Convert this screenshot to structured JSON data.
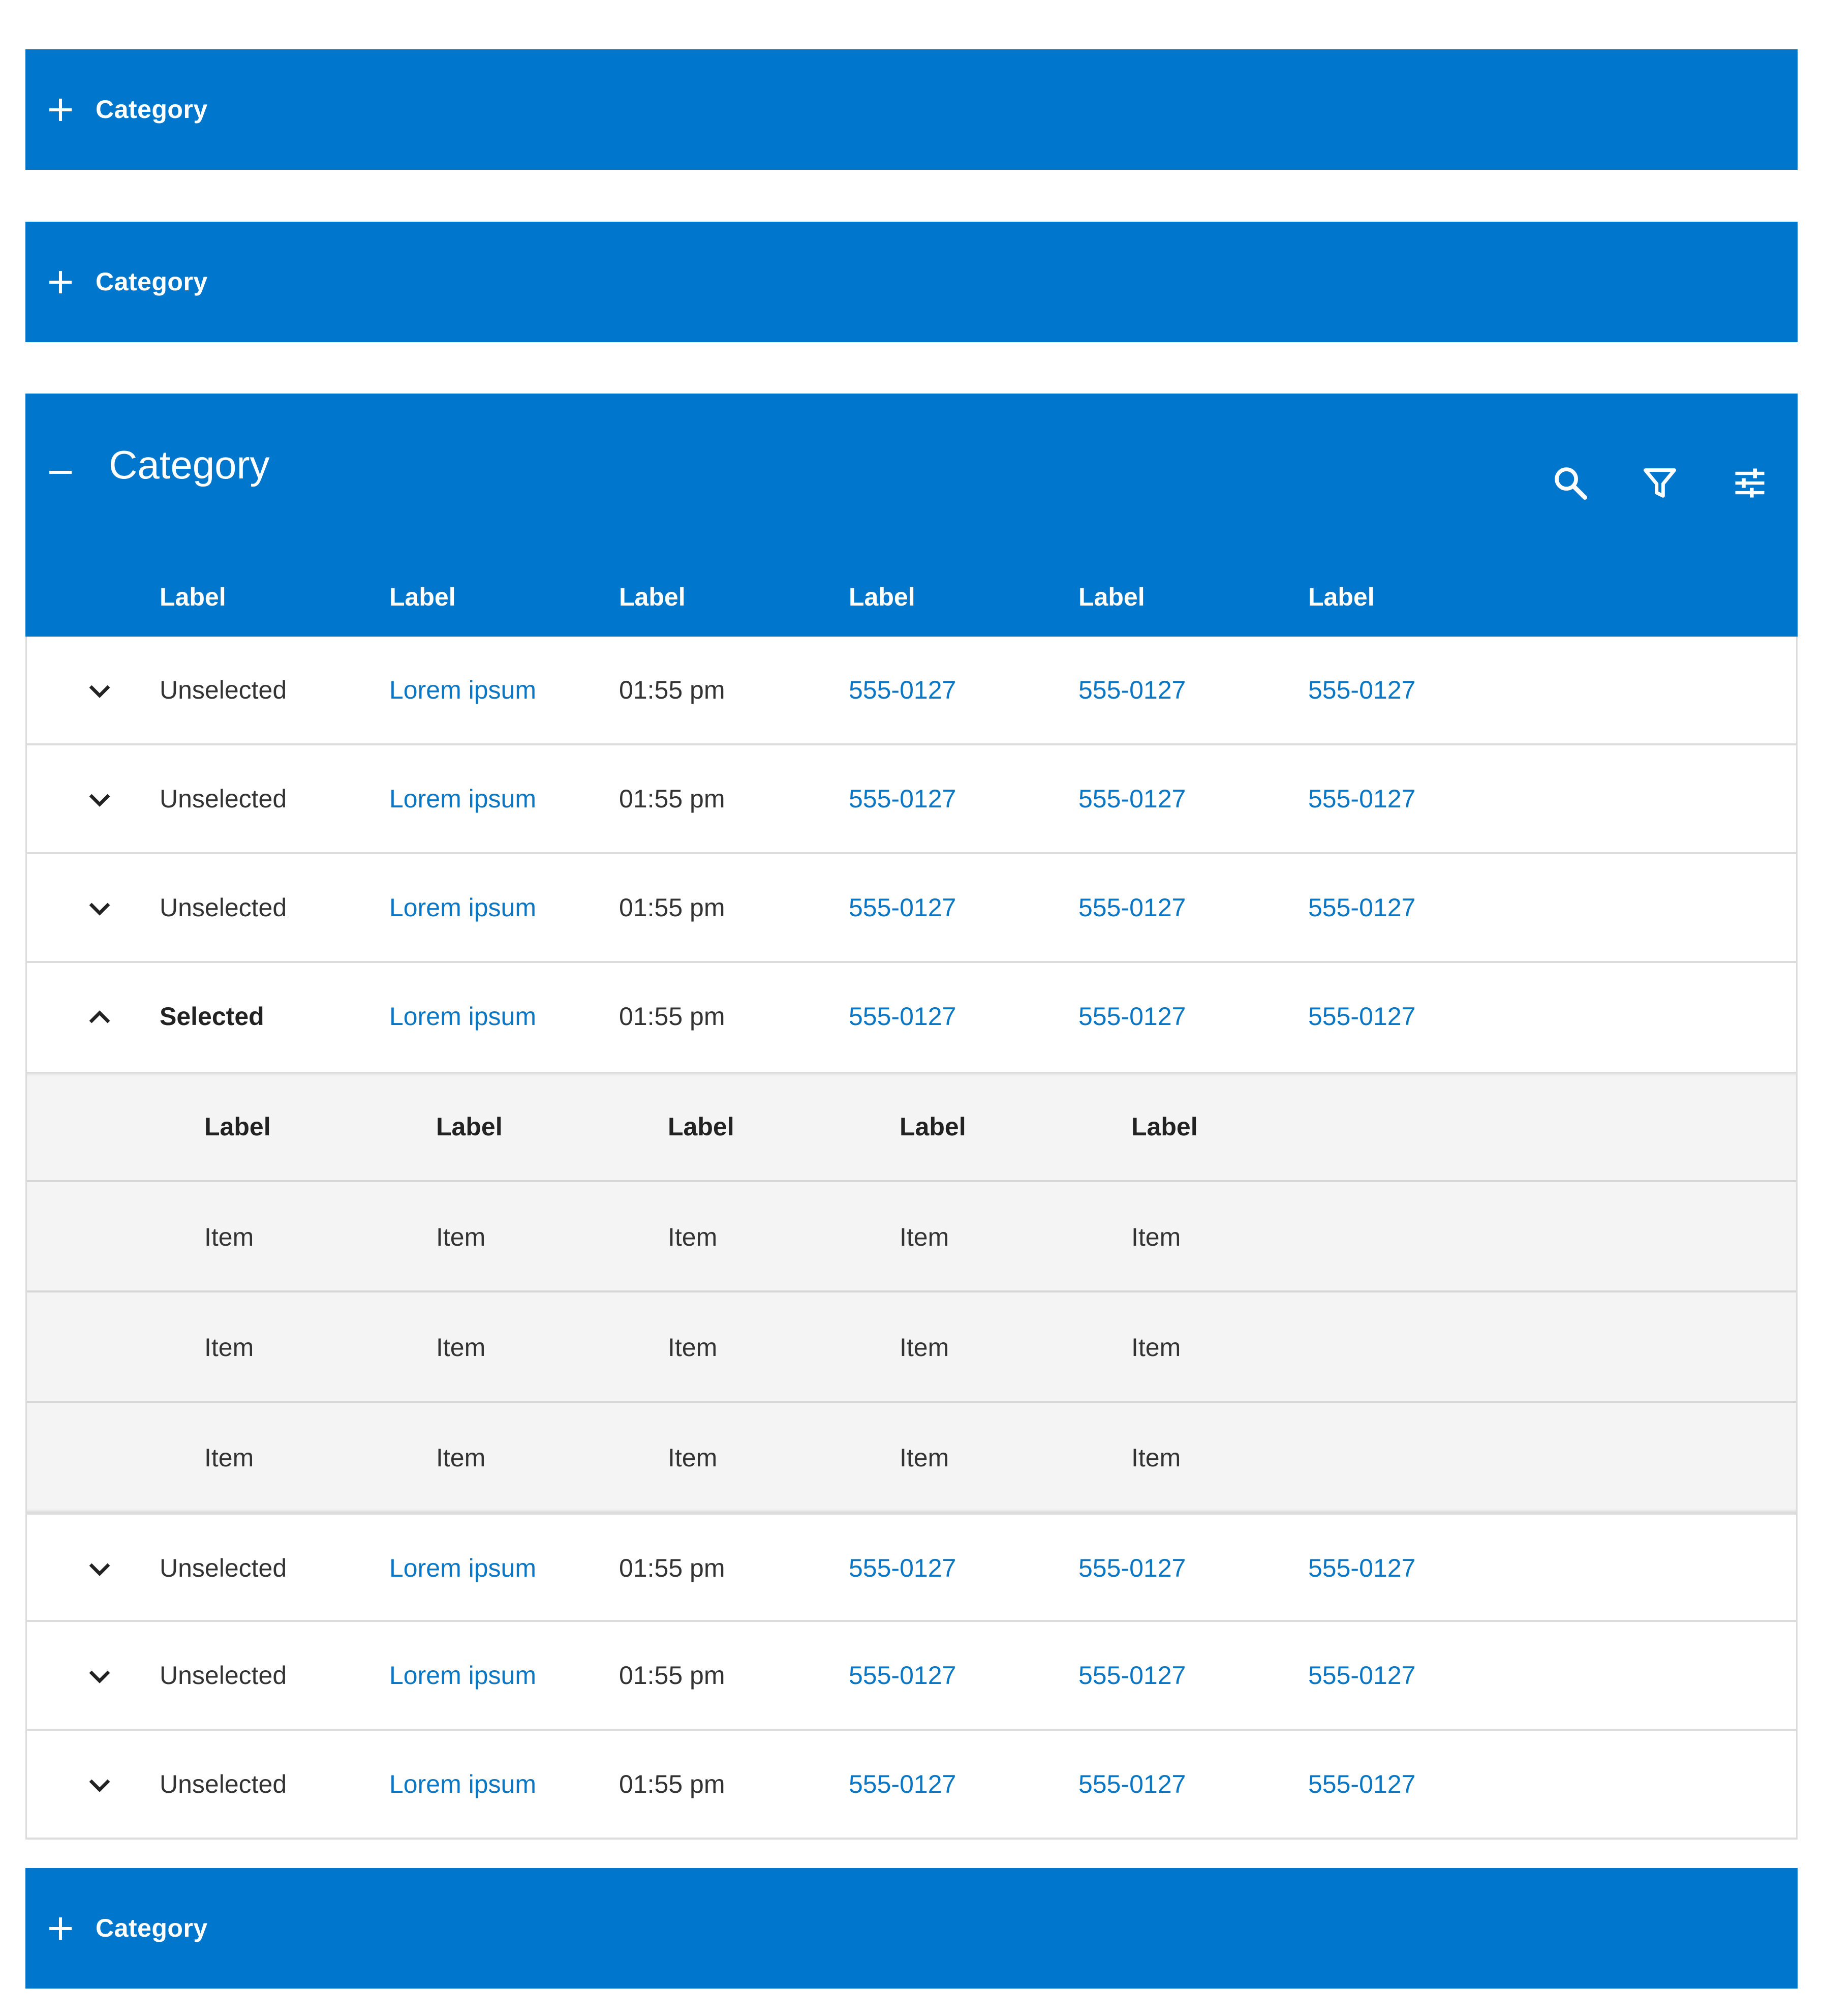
{
  "colors": {
    "accent": "#0077cc",
    "link": "#0a76c4",
    "sub_bg": "#f4f4f4"
  },
  "collapsed_categories": [
    {
      "label": "Category",
      "icon": "plus-icon"
    },
    {
      "label": "Category",
      "icon": "plus-icon"
    },
    {
      "label": "Category",
      "icon": "plus-icon"
    }
  ],
  "panel": {
    "title": "Category",
    "toggle_icon": "minus-icon",
    "toolbar_icons": [
      "search-icon",
      "filter-icon",
      "settings-sliders-icon"
    ],
    "columns": [
      "Label",
      "Label",
      "Label",
      "Label",
      "Label",
      "Label"
    ],
    "rows": [
      {
        "status": "Unselected",
        "link": "Lorem ipsum",
        "time": "01:55 pm",
        "phones": [
          "555-0127",
          "555-0127",
          "555-0127"
        ]
      },
      {
        "status": "Unselected",
        "link": "Lorem ipsum",
        "time": "01:55 pm",
        "phones": [
          "555-0127",
          "555-0127",
          "555-0127"
        ]
      },
      {
        "status": "Unselected",
        "link": "Lorem ipsum",
        "time": "01:55 pm",
        "phones": [
          "555-0127",
          "555-0127",
          "555-0127"
        ]
      },
      {
        "status": "Selected",
        "link": "Lorem ipsum",
        "time": "01:55 pm",
        "phones": [
          "555-0127",
          "555-0127",
          "555-0127"
        ]
      },
      {
        "status": "Unselected",
        "link": "Lorem ipsum",
        "time": "01:55 pm",
        "phones": [
          "555-0127",
          "555-0127",
          "555-0127"
        ]
      },
      {
        "status": "Unselected",
        "link": "Lorem ipsum",
        "time": "01:55 pm",
        "phones": [
          "555-0127",
          "555-0127",
          "555-0127"
        ]
      },
      {
        "status": "Unselected",
        "link": "Lorem ipsum",
        "time": "01:55 pm",
        "phones": [
          "555-0127",
          "555-0127",
          "555-0127"
        ]
      }
    ],
    "expanded_detail": {
      "columns": [
        "Label",
        "Label",
        "Label",
        "Label",
        "Label"
      ],
      "rows": [
        [
          "Item",
          "Item",
          "Item",
          "Item",
          "Item"
        ],
        [
          "Item",
          "Item",
          "Item",
          "Item",
          "Item"
        ],
        [
          "Item",
          "Item",
          "Item",
          "Item",
          "Item"
        ]
      ]
    }
  }
}
